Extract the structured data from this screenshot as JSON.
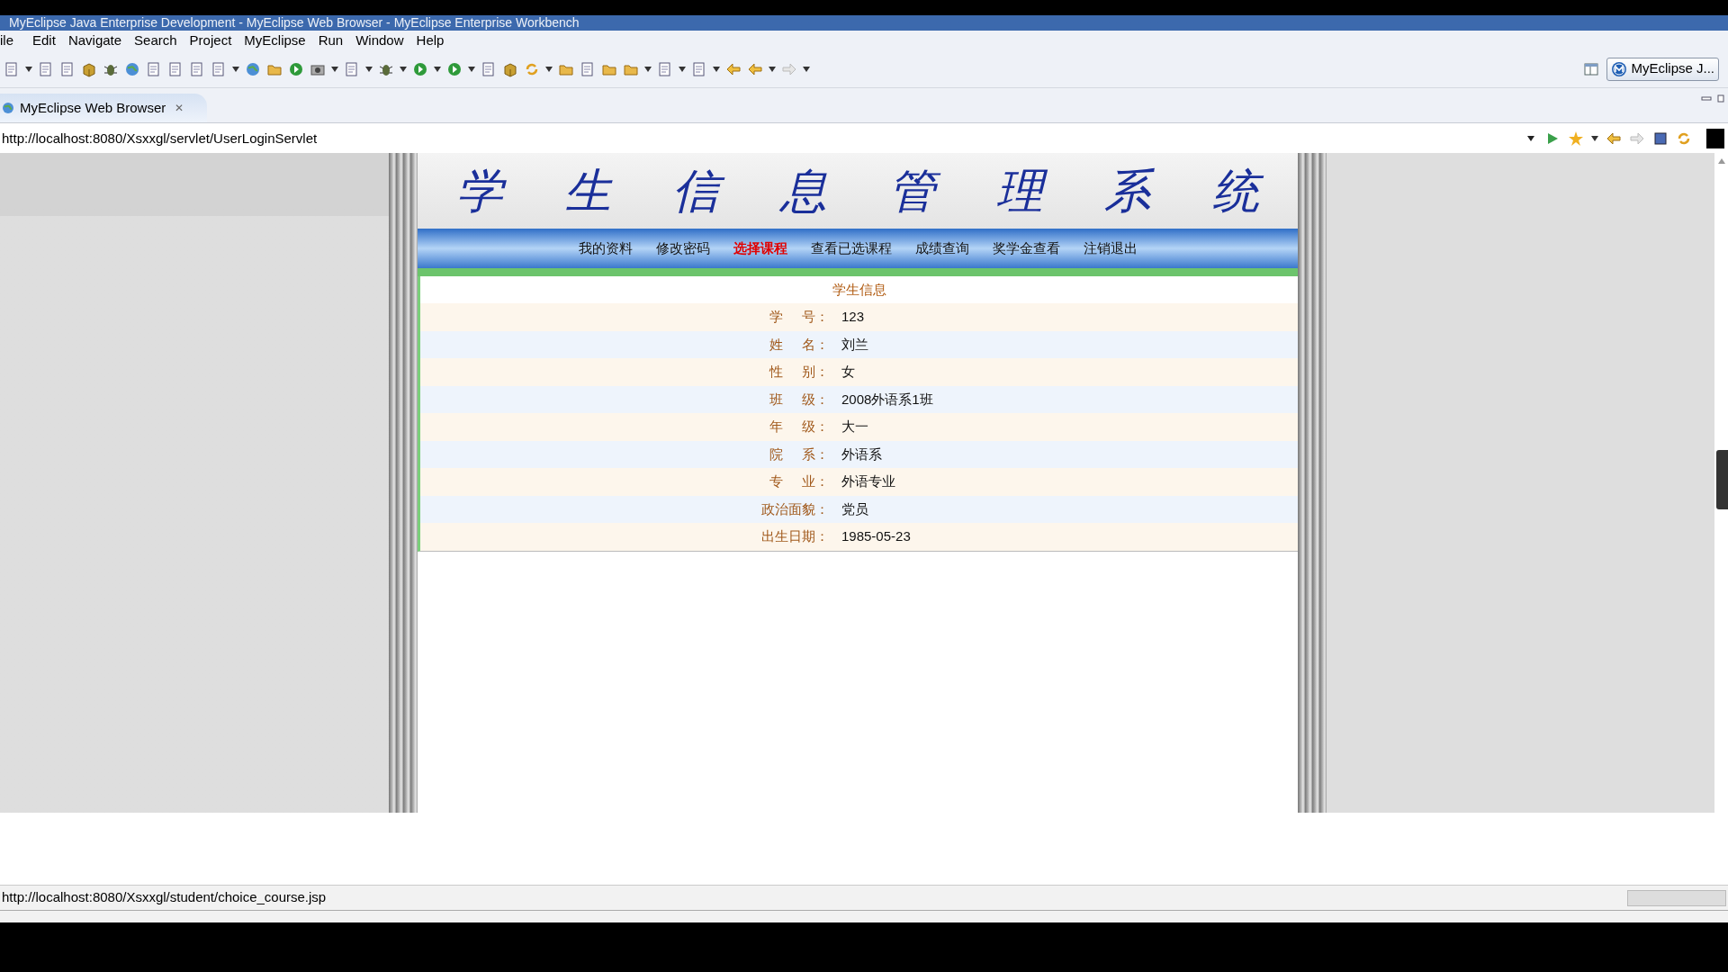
{
  "window": {
    "title": "MyEclipse Java Enterprise Development - MyEclipse Web Browser - MyEclipse Enterprise Workbench"
  },
  "menu": [
    "ile",
    "Edit",
    "Navigate",
    "Search",
    "Project",
    "MyEclipse",
    "Run",
    "Window",
    "Help"
  ],
  "perspective": {
    "label": "MyEclipse J..."
  },
  "editor_tab": {
    "label": "MyEclipse Web Browser",
    "close": "✕"
  },
  "address_bar": {
    "value": "http://localhost:8080/Xsxxgl/servlet/UserLoginServlet"
  },
  "page": {
    "banner": [
      "学",
      "生",
      "信",
      "息",
      "管",
      "理",
      "系",
      "统"
    ],
    "nav": [
      {
        "label": "我的资料",
        "hovered": false
      },
      {
        "label": "修改密码",
        "hovered": false
      },
      {
        "label": "选择课程",
        "hovered": true
      },
      {
        "label": "查看已选课程",
        "hovered": false
      },
      {
        "label": "成绩查询",
        "hovered": false
      },
      {
        "label": "奖学金查看",
        "hovered": false
      },
      {
        "label": "注销退出",
        "hovered": false
      }
    ],
    "table_title": "学生信息",
    "rows": [
      {
        "label": [
          "学",
          "号："
        ],
        "value": "123"
      },
      {
        "label": [
          "姓",
          "名："
        ],
        "value": "刘兰"
      },
      {
        "label": [
          "性",
          "别："
        ],
        "value": "女"
      },
      {
        "label": [
          "班",
          "级："
        ],
        "value": "2008外语系1班"
      },
      {
        "label": [
          "年",
          "级："
        ],
        "value": "大一"
      },
      {
        "label": [
          "院",
          "系："
        ],
        "value": "外语系"
      },
      {
        "label": [
          "专",
          "业："
        ],
        "value": "外语专业"
      },
      {
        "label": [
          "政治面貌："
        ],
        "value": "党员"
      },
      {
        "label": [
          "出生日期："
        ],
        "value": "1985-05-23"
      }
    ]
  },
  "status_bar": {
    "text": "http://localhost:8080/Xsxxgl/student/choice_course.jsp"
  }
}
